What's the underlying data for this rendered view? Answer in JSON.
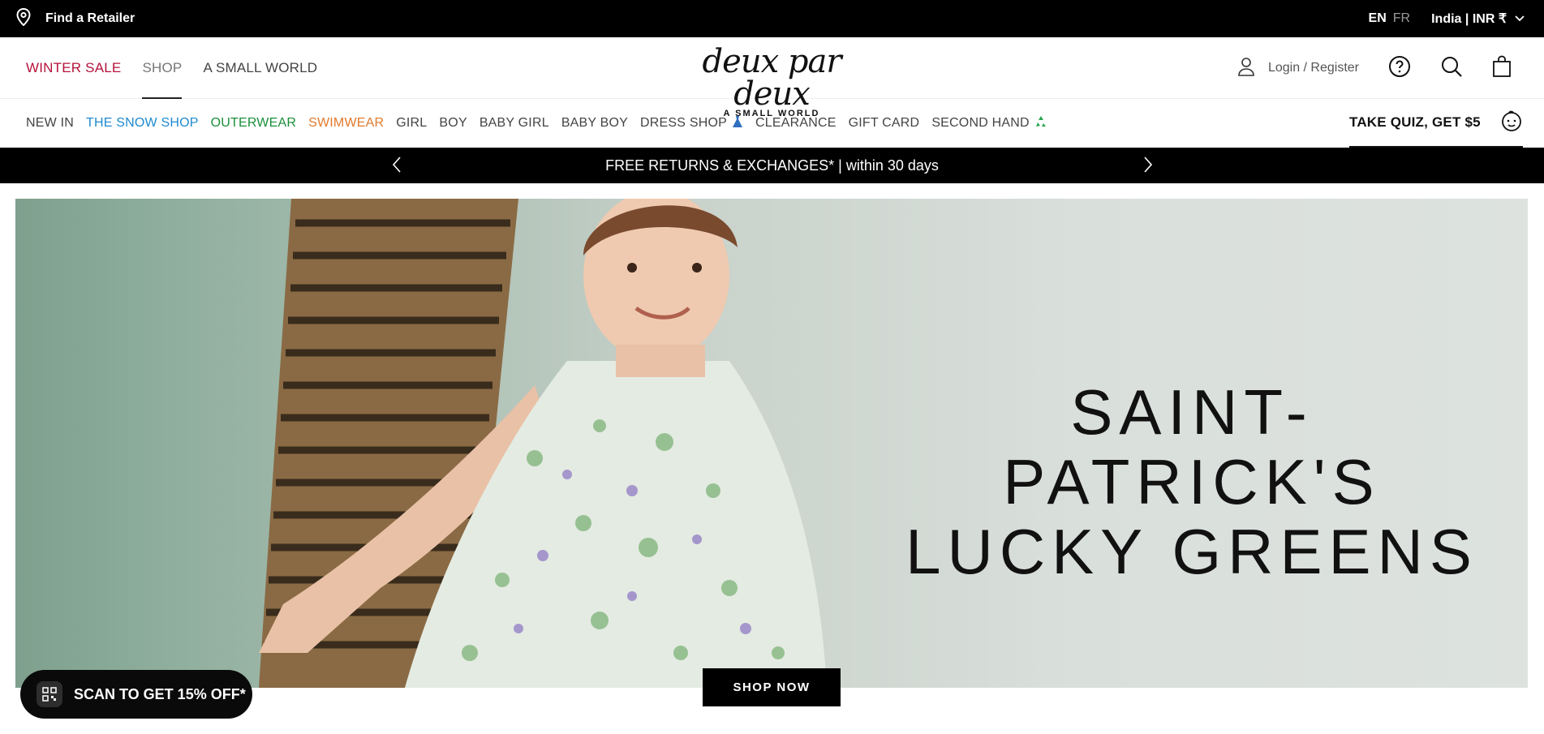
{
  "utility": {
    "retailer": "Find a Retailer",
    "lang_active": "EN",
    "lang_inactive": "FR",
    "region": "India | INR ₹"
  },
  "header": {
    "nav": [
      "WINTER SALE",
      "SHOP",
      "A SMALL WORLD"
    ],
    "logo_text": "deux par deux",
    "logo_tagline": "A SMALL WORLD",
    "login": "Login / Register"
  },
  "categories": {
    "items": [
      "NEW IN",
      "THE SNOW SHOP",
      "OUTERWEAR",
      "SWIMWEAR",
      "GIRL",
      "BOY",
      "BABY GIRL",
      "BABY BOY",
      "DRESS SHOP",
      "CLEARANCE",
      "GIFT CARD",
      "SECOND HAND"
    ],
    "quiz": "TAKE QUIZ, GET $5"
  },
  "promo": {
    "text": "FREE RETURNS & EXCHANGES* | within 30 days"
  },
  "hero": {
    "line1": "SAINT-PATRICK'S",
    "line2": "LUCKY GREENS",
    "cta": "SHOP NOW"
  },
  "scan": {
    "text": "SCAN TO GET 15% OFF*"
  },
  "colors": {
    "sale": "#b5123a",
    "snow": "#1f8ad0",
    "outerwear": "#1b8f3b",
    "swimwear": "#e07a2c"
  },
  "icons": [
    "location-pin-icon",
    "chevron-down-icon",
    "user-icon",
    "help-icon",
    "search-icon",
    "bag-icon",
    "dress-icon",
    "recycle-icon",
    "baby-face-icon",
    "chevron-left-icon",
    "chevron-right-icon",
    "qr-icon"
  ]
}
